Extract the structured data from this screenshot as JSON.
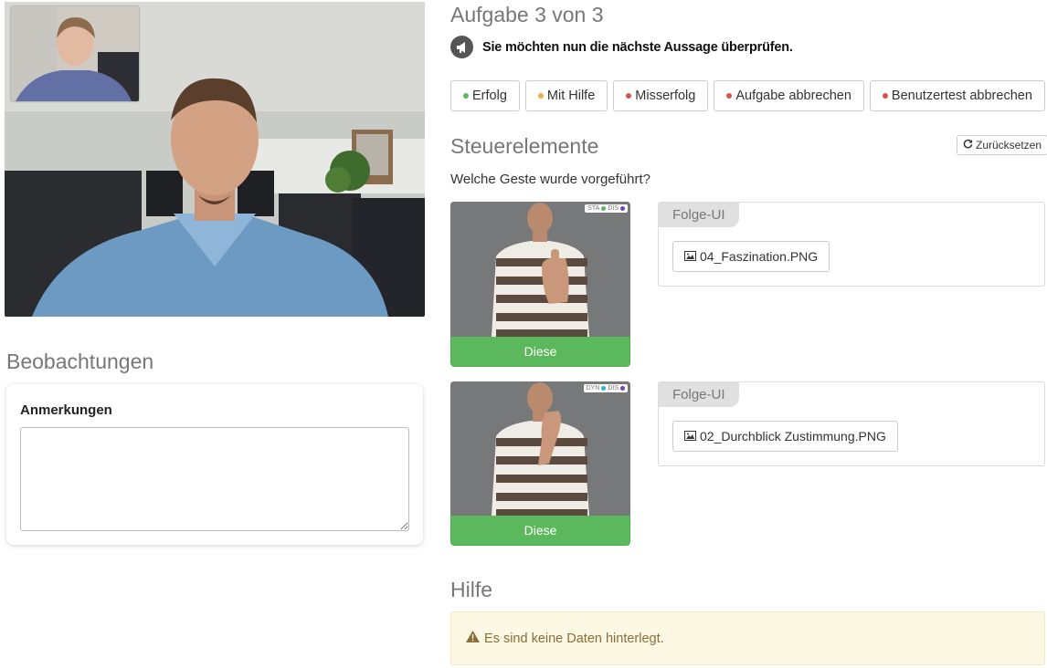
{
  "task": {
    "title": "Aufgabe 3 von 3",
    "hint": "Sie möchten nun die nächste Aussage überprüfen."
  },
  "buttons": [
    {
      "label": "Erfolg",
      "dot_color": "#5cb85c"
    },
    {
      "label": "Mit Hilfe",
      "dot_color": "#f0ad4e"
    },
    {
      "label": "Misserfolg",
      "dot_color": "#d9534f"
    },
    {
      "label": "Aufgabe abbrechen",
      "dot_color": "#d9534f"
    },
    {
      "label": "Benutzertest abbrechen",
      "dot_color": "#d9534f"
    }
  ],
  "observations": {
    "title": "Beobachtungen",
    "notes_label": "Anmerkungen",
    "notes_value": ""
  },
  "controls": {
    "title": "Steuerelemente",
    "reset_label": "Zurücksetzen",
    "question": "Welche Geste wurde vorgeführt?",
    "gestures": [
      {
        "tag1": "STA",
        "tag1_color": "#5cb85c",
        "tag2": "DIS",
        "tag2_color": "#6f42c1",
        "choose_label": "Diese",
        "panel_label": "Folge-UI",
        "file": "04_Faszination.PNG"
      },
      {
        "tag1": "DYN",
        "tag1_color": "#31b0d5",
        "tag2": "DIS",
        "tag2_color": "#6f42c1",
        "choose_label": "Diese",
        "panel_label": "Folge-UI",
        "file": "02_Durchblick Zustimmung.PNG"
      }
    ]
  },
  "help": {
    "title": "Hilfe",
    "message": "Es sind keine Daten hinterlegt."
  },
  "icons": {
    "hint": "megaphone-icon",
    "reset": "refresh-icon",
    "file": "image-icon",
    "alert": "warning-icon"
  }
}
